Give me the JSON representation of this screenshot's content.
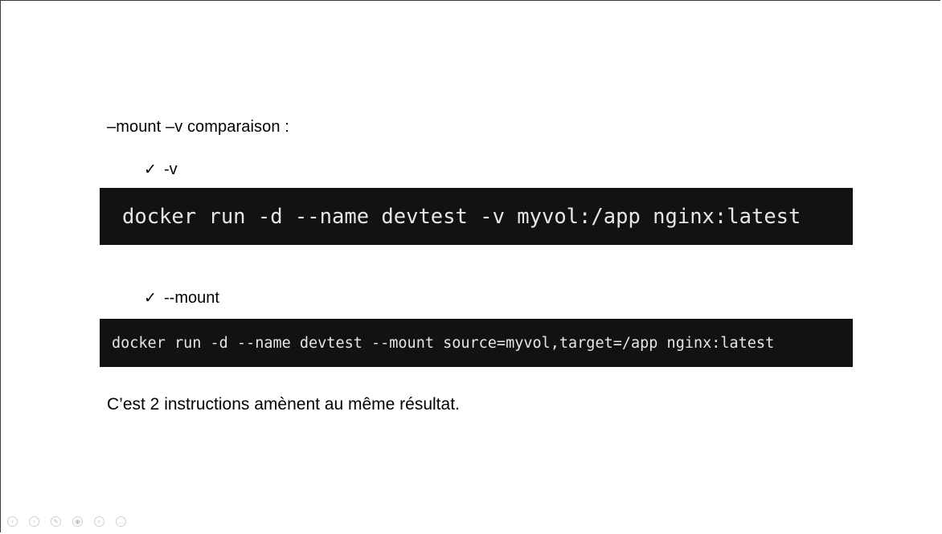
{
  "slide": {
    "heading": "–mount –v comparaison :",
    "bullets": [
      {
        "check": "✓",
        "label": "-v"
      },
      {
        "check": "✓",
        "label": "--mount"
      }
    ],
    "code_v": "docker run -d --name devtest -v myvol:/app nginx:latest",
    "code_mount": "docker run -d --name devtest --mount source=myvol,target=/app nginx:latest",
    "conclusion": "C’est 2 instructions amènent au même résultat."
  },
  "toolbar": {
    "icons": [
      "prev-icon",
      "next-icon",
      "pen-icon",
      "pointer-icon",
      "zoom-icon",
      "more-icon"
    ],
    "glyphs": [
      "‹",
      "›",
      "✎",
      "◉",
      "⌕",
      "…"
    ]
  },
  "colors": {
    "code_background": "#111214",
    "code_text": "#e6e6e6"
  }
}
